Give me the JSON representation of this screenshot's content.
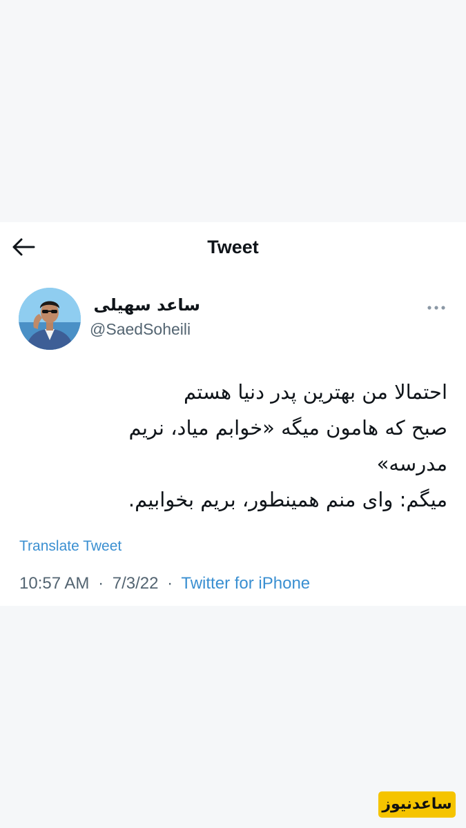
{
  "header": {
    "title": "Tweet",
    "back_icon": "arrow-left-icon"
  },
  "author": {
    "display_name": "ساعد سهیلی",
    "handle": "@SaedSoheili",
    "more_icon": "more-horizontal-icon"
  },
  "tweet": {
    "lines": [
      "احتمالا من بهترین پدر دنیا هستم",
      "صبح که هامون میگه «خوابم میاد، نریم",
      "مدرسه»",
      "میگم: وای منم همینطور، بریم بخوابیم."
    ],
    "translate_label": "Translate Tweet",
    "time": "10:57 AM",
    "date": "7/3/22",
    "separator": "·",
    "source": "Twitter for iPhone"
  },
  "watermark": {
    "text": "ساعدنیوز",
    "color": "#f5c400"
  },
  "colors": {
    "link": "#3a8fd1",
    "text": "#0f1419",
    "secondary": "#536471",
    "background": "#f5f7f9"
  }
}
